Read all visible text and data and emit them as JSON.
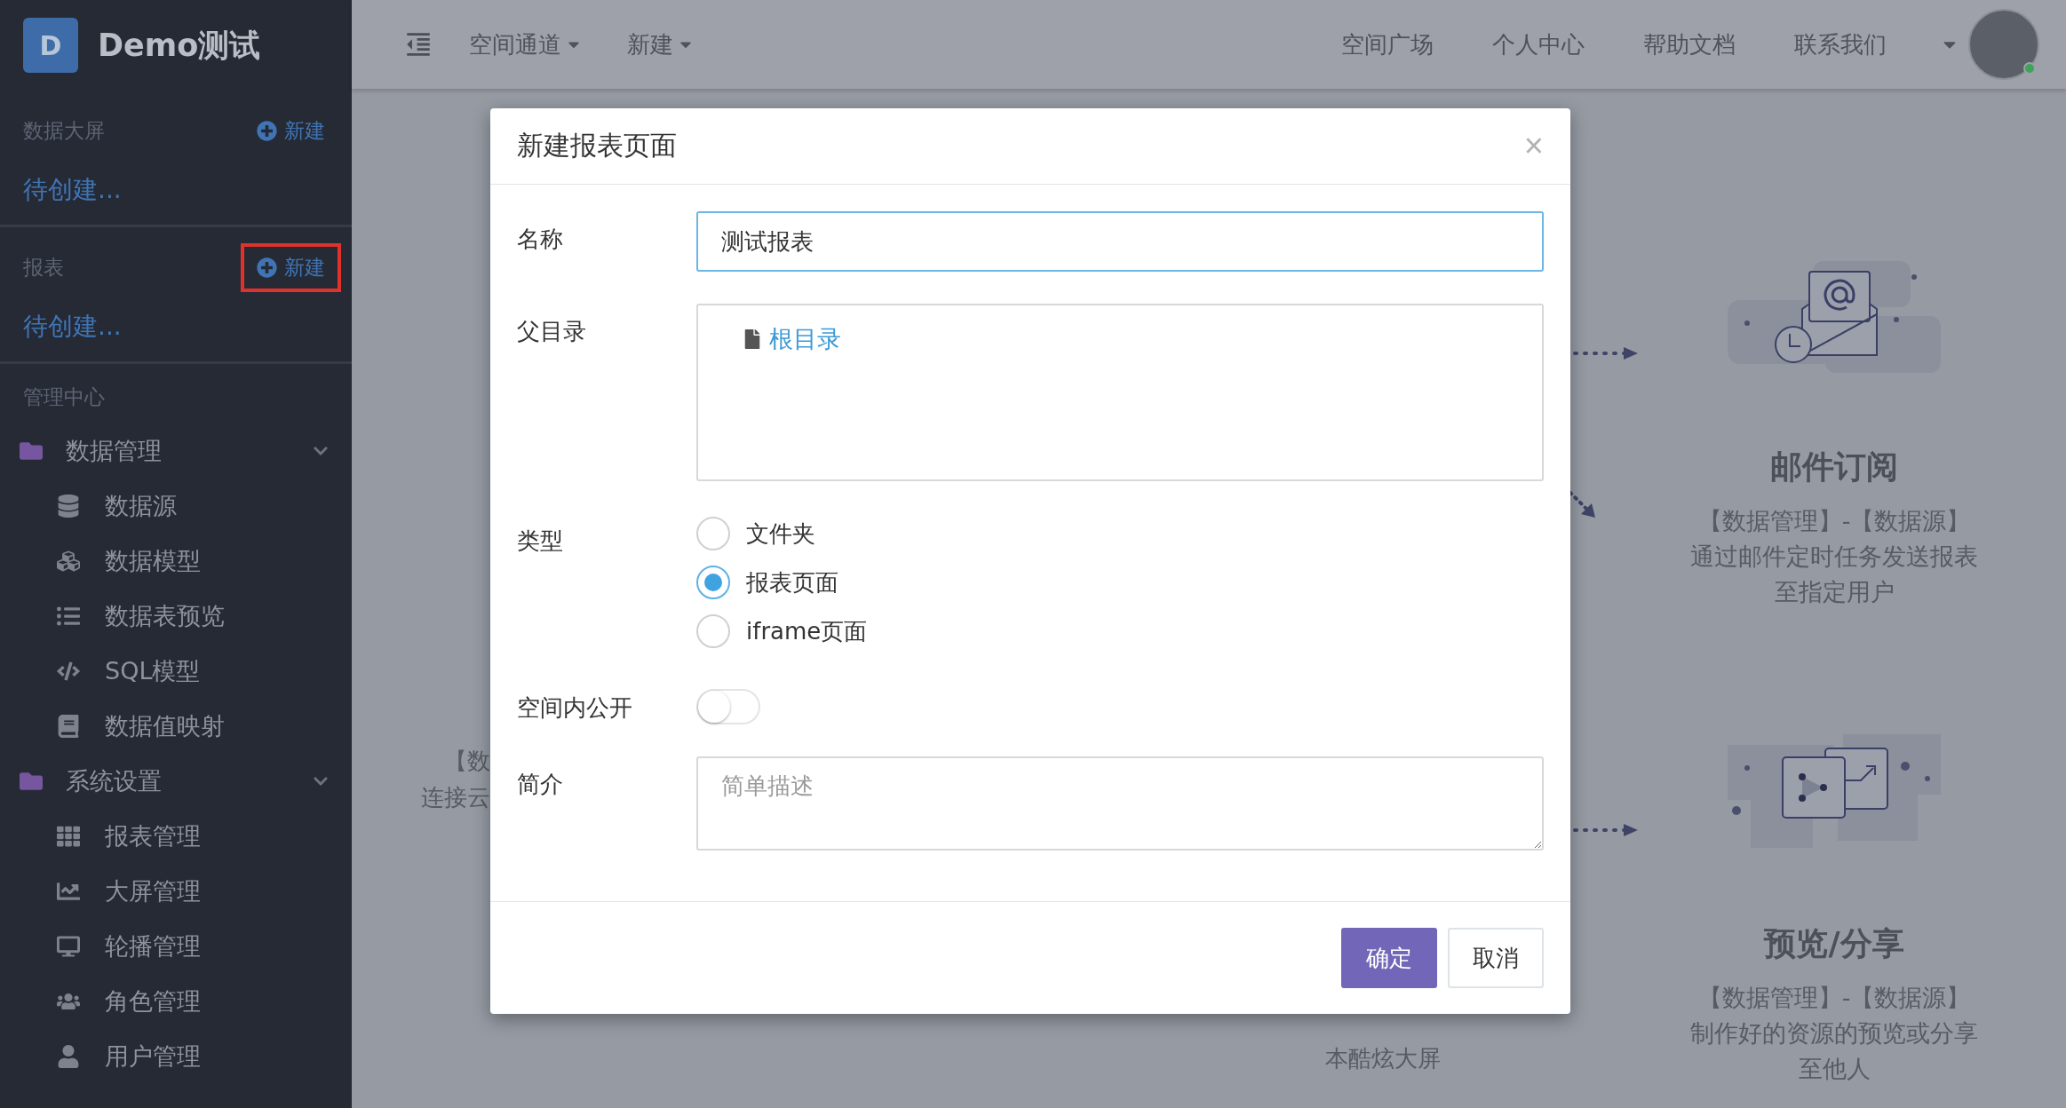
{
  "sidebar": {
    "logo_letter": "D",
    "title": "Demo测试",
    "sections": [
      {
        "label": "数据大屏",
        "new_link": "新建",
        "highlighted": false,
        "placeholder_item": "待创建..."
      },
      {
        "label": "报表",
        "new_link": "新建",
        "highlighted": true,
        "placeholder_item": "待创建..."
      }
    ],
    "management": {
      "label": "管理中心",
      "groups": [
        {
          "label": "数据管理",
          "expanded": true,
          "children": [
            {
              "label": "数据源",
              "kind": "database"
            },
            {
              "label": "数据模型",
              "kind": "cubes"
            },
            {
              "label": "数据表预览",
              "kind": "list"
            },
            {
              "label": "SQL模型",
              "kind": "code"
            },
            {
              "label": "数据值映射",
              "kind": "book"
            }
          ]
        },
        {
          "label": "系统设置",
          "expanded": true,
          "children": [
            {
              "label": "报表管理",
              "kind": "grid"
            },
            {
              "label": "大屏管理",
              "kind": "chart"
            },
            {
              "label": "轮播管理",
              "kind": "monitor"
            },
            {
              "label": "角色管理",
              "kind": "users"
            },
            {
              "label": "用户管理",
              "kind": "user"
            }
          ]
        }
      ]
    }
  },
  "topbar": {
    "menus": [
      {
        "label": "空间通道",
        "dropdown": true
      },
      {
        "label": "新建",
        "dropdown": true
      }
    ],
    "links": [
      "空间广场",
      "个人中心",
      "帮助文档",
      "联系我们"
    ],
    "user_online": true
  },
  "background": {
    "left_fragments": [
      "【数",
      "连接云"
    ],
    "features": [
      {
        "kind": "email",
        "title": "邮件订阅",
        "lines": [
          "【数据管理】-【数据源】",
          "通过邮件定时任务发送报表",
          "至指定用户"
        ]
      },
      {
        "kind": "share",
        "title": "预览/分享",
        "lines": [
          "【数据管理】-【数据源】",
          "制作好的资源的预览或分享",
          "至他人"
        ]
      }
    ],
    "middle_line": "本酷炫大屏"
  },
  "modal": {
    "title": "新建报表页面",
    "close": "×",
    "name": {
      "label": "名称",
      "value": "测试报表"
    },
    "parent": {
      "label": "父目录",
      "tree": [
        {
          "label": "根目录"
        }
      ]
    },
    "type": {
      "label": "类型",
      "options": [
        {
          "label": "文件夹",
          "selected": false
        },
        {
          "label": "报表页面",
          "selected": true
        },
        {
          "label": "iframe页面",
          "selected": false
        }
      ]
    },
    "public": {
      "label": "空间内公开",
      "on": false
    },
    "intro": {
      "label": "简介",
      "placeholder": "简单描述"
    },
    "buttons": [
      {
        "label": "确定",
        "kind": "primary"
      },
      {
        "label": "取消",
        "kind": "default"
      }
    ]
  }
}
